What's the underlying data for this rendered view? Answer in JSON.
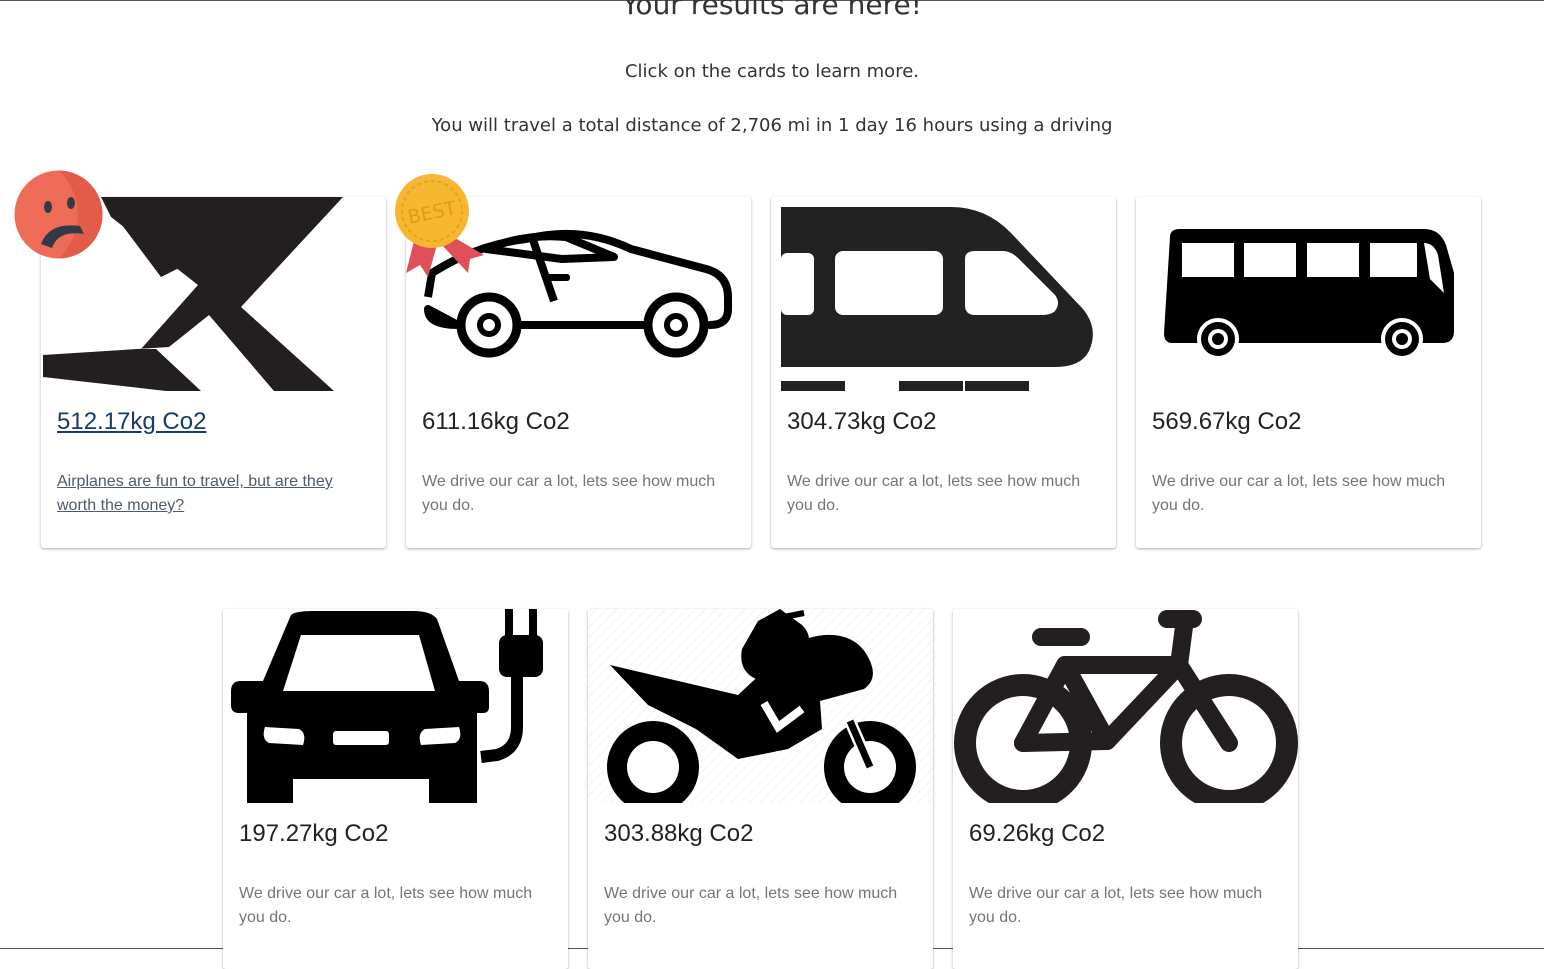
{
  "header": {
    "title": "Your results are here!",
    "instruction": "Click on the cards to learn more.",
    "summary": "You will travel a total distance of 2,706 mi in 1 day 16 hours using a driving"
  },
  "cards": [
    {
      "mode": "airplane",
      "co2": "512.17kg Co2",
      "description": "Airplanes are fun to travel, but are they worth the money?",
      "badge": "sad-face"
    },
    {
      "mode": "car",
      "co2": "611.16kg Co2",
      "description": "We drive our car a lot, lets see how much you do.",
      "badge": "best-medal",
      "badge_text": "BEST"
    },
    {
      "mode": "train",
      "co2": "304.73kg Co2",
      "description": "We drive our car a lot, lets see how much you do."
    },
    {
      "mode": "bus",
      "co2": "569.67kg Co2",
      "description": "We drive our car a lot, lets see how much you do."
    },
    {
      "mode": "electric-car",
      "co2": "197.27kg Co2",
      "description": "We drive our car a lot, lets see how much you do."
    },
    {
      "mode": "motorcycle",
      "co2": "303.88kg Co2",
      "description": "We drive our car a lot, lets see how much you do."
    },
    {
      "mode": "bicycle",
      "co2": "69.26kg Co2",
      "description": "We drive our car a lot, lets see how much you do."
    }
  ],
  "colors": {
    "sad_badge": "#ee6b57",
    "medal_gold": "#f7b731",
    "medal_ribbon": "#e0505b",
    "icon": "#1f1d1d"
  }
}
